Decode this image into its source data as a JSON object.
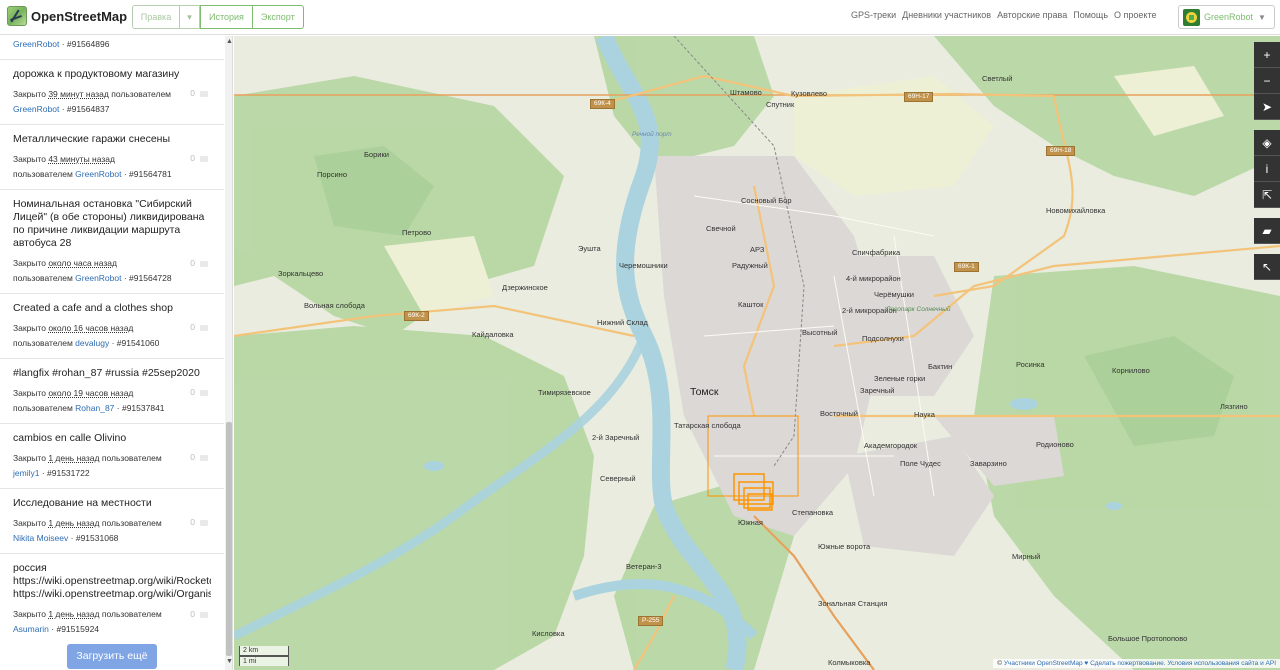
{
  "header": {
    "logo_text": "OpenStreetMap",
    "edit_label": "Правка",
    "history_label": "История",
    "export_label": "Экспорт",
    "nav": [
      "GPS-треки",
      "Дневники участников",
      "Авторские права",
      "Помощь",
      "О проекте"
    ],
    "user_name": "GreenRobot"
  },
  "sidebar": {
    "top_fragment": {
      "user": "GreenRobot",
      "id": "· #91564896"
    },
    "items": [
      {
        "title": "дорожка к продуктовому магазину",
        "status": "Закрыто",
        "time": "39 минут назад",
        "by": "пользователем",
        "user": "GreenRobot",
        "id": "· #91564837",
        "comments": "0"
      },
      {
        "title": "Металлические гаражи снесены",
        "status": "Закрыто",
        "time": "43 минуты назад",
        "by": "пользователем",
        "user": "GreenRobot",
        "id": "· #91564781",
        "comments": "0"
      },
      {
        "title_lines": [
          "Номинальная остановка \"Сибирский",
          "Лицей\" (в обе стороны) ликвидирована",
          "по причине ликвидации маршрута",
          "автобуса 28"
        ],
        "status": "Закрыто",
        "time": "около часа назад",
        "by": "пользователем",
        "user": "GreenRobot",
        "id": "· #91564728",
        "comments": "0"
      },
      {
        "title": "Created a cafe and a clothes shop",
        "status": "Закрыто",
        "time": "около 16 часов назад",
        "by": "пользователем",
        "user": "devalugy",
        "id": "· #91541060",
        "comments": "0"
      },
      {
        "title": "#langfix #rohan_87 #russia #25sep2020",
        "status": "Закрыто",
        "time": "около 19 часов назад",
        "by": "пользователем",
        "user": "Rohan_87",
        "id": "· #91537841",
        "comments": "0"
      },
      {
        "title": "cambios en calle Olivino",
        "status": "Закрыто",
        "time": "1 день назад",
        "by": "пользователем",
        "user": "jemily1",
        "id": "· #91531722",
        "comments": "0"
      },
      {
        "title": "Исследование на местности",
        "status": "Закрыто",
        "time": "1 день назад",
        "by": "пользователем",
        "user": "Nikita Moiseev",
        "id": "· #91531068",
        "comments": "0"
      },
      {
        "title_lines": [
          "россия",
          "https://wiki.openstreetmap.org/wiki/Rocketda",
          "https://wiki.openstreetmap.org/wiki/Organise"
        ],
        "status": "Закрыто",
        "time": "1 день назад",
        "by": "пользователем",
        "user": "Asumarin",
        "id": "· #91515924",
        "comments": "0"
      }
    ],
    "load_more": "Загрузить ещё"
  },
  "map": {
    "city_label": "Томск",
    "labels": [
      "Светлый",
      "Штамово",
      "Спутник",
      "Кузовлево",
      "Речной порт",
      "Борики",
      "Порсино",
      "Петрово",
      "Сосновый Бор",
      "Свечной",
      "Эушта",
      "АРЗ",
      "Черемошники",
      "Радужный",
      "Спичфабрика",
      "4-й микрорайон",
      "Черёмушки",
      "Зоркальцево",
      "Вольная слобода",
      "Дзержинское",
      "Кашток",
      "2-й микрорайон",
      "Лесопарк Солнечный",
      "Нижний Склад",
      "Высотный",
      "Подсолнухи",
      "Кайдаловка",
      "Бактин",
      "Росинка",
      "Корнилово",
      "Зеленые горки",
      "Заречный",
      "Тимирязевское",
      "Восточный",
      "Наука",
      "Лязгино",
      "Татарская слобода",
      "Академгородок",
      "2-й Заречный",
      "Поле Чудес",
      "Заварзино",
      "Родионово",
      "Северный",
      "Степановка",
      "Южная",
      "Южные ворота",
      "Мирный",
      "Ветеран-3",
      "Зональная Станция",
      "Кисловка",
      "Большое Протопопово",
      "Колмыковка",
      "Новомихайловка"
    ],
    "shields": [
      "69К-4",
      "69Н-17",
      "69Н-18",
      "69К-1",
      "69К-2",
      "Р-255"
    ],
    "zoom_in": "+",
    "zoom_out": "−",
    "scale_km": "2 km",
    "scale_mi": "1 mi",
    "attribution_prefix": "©",
    "attribution_link": "Участники OpenStreetMap",
    "attribution_donate": "♥ Сделать пожертвование.",
    "attribution_terms": "Условия использования сайта и API"
  }
}
